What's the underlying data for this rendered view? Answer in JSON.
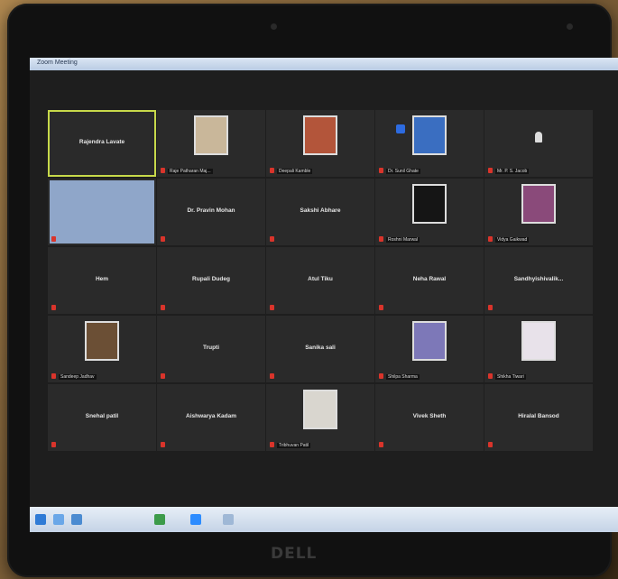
{
  "window": {
    "title": "Zoom Meeting"
  },
  "participants": [
    {
      "name": "Rajendra Lavate",
      "label": "",
      "video": false,
      "active": true
    },
    {
      "name": "",
      "label": "Raje Patharan Maj...",
      "video": true,
      "color": "#c9b79a"
    },
    {
      "name": "",
      "label": "Deepali Kamble",
      "video": true,
      "color": "#b3553a"
    },
    {
      "name": "",
      "label": "Dr. Sunil Ghate",
      "video": true,
      "color": "#3a6ec1",
      "pinned": true
    },
    {
      "name": "",
      "label": "Mr. P. S. Jacob",
      "video": false,
      "icon": "user-icon"
    },
    {
      "name": "",
      "label": "",
      "video": true,
      "color": "#8fa6c9",
      "wide": true
    },
    {
      "name": "Dr. Pravin Mohan",
      "label": "",
      "video": false
    },
    {
      "name": "Sakshi Abhare",
      "label": "",
      "video": false
    },
    {
      "name": "",
      "label": "Roshni Marwal",
      "video": true,
      "color": "#151515"
    },
    {
      "name": "",
      "label": "Vidya Gaikwad",
      "video": true,
      "color": "#8a4a7a"
    },
    {
      "name": "Hem",
      "label": "",
      "video": false
    },
    {
      "name": "Rupali Dudeg",
      "label": "",
      "video": false
    },
    {
      "name": "Atul Tiku",
      "label": "",
      "video": false
    },
    {
      "name": "Neha Rawal",
      "label": "",
      "video": false
    },
    {
      "name": "Sandhyishivalik...",
      "label": "",
      "video": false
    },
    {
      "name": "",
      "label": "Sandeep Jadhav",
      "video": true,
      "color": "#6b4f35"
    },
    {
      "name": "Trupti",
      "label": "",
      "video": false
    },
    {
      "name": "Sanika sali",
      "label": "",
      "video": false
    },
    {
      "name": "",
      "label": "Shilpa Sharma",
      "video": true,
      "color": "#7d78b8"
    },
    {
      "name": "",
      "label": "Shikha Tiwari",
      "video": true,
      "color": "#e8e2ea"
    },
    {
      "name": "Snehal patil",
      "label": "",
      "video": false
    },
    {
      "name": "Aishwarya Kadam",
      "label": "",
      "video": false
    },
    {
      "name": "",
      "label": "Tribhuvan Patil",
      "video": true,
      "color": "#d9d6cf"
    },
    {
      "name": "Vivek Sheth",
      "label": "",
      "video": false
    },
    {
      "name": "Hiralal Bansod",
      "label": "",
      "video": false
    }
  ],
  "monitor": {
    "brand": "DELL"
  },
  "colors": {
    "tile_bg": "#2a2a2a",
    "active_border": "#c7d94a",
    "muted": "#d9342b",
    "screen_bg": "#1e1e1e"
  }
}
